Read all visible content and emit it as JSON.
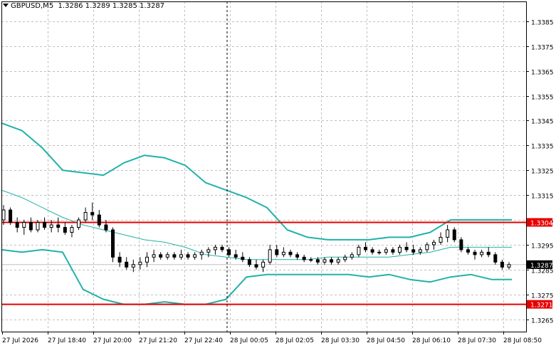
{
  "header": {
    "symbol": "GBPUSD,M5",
    "ohlc": "1.3286 1.3289 1.3285 1.3287"
  },
  "colors": {
    "background": "#ffffff",
    "grid": "#c0c0c0",
    "axis": "#000000",
    "bands": "#20b2aa",
    "level_line": "#e60000",
    "candle": "#000000"
  },
  "chart_data": {
    "type": "candlestick",
    "symbol": "GBPUSD",
    "timeframe": "M5",
    "ylim": [
      1.326,
      1.3393
    ],
    "y_ticks": [
      "1.3385",
      "1.3375",
      "1.3365",
      "1.3355",
      "1.3345",
      "1.3335",
      "1.3325",
      "1.3315",
      "1.3305",
      "1.3295",
      "1.3285",
      "1.3275",
      "1.3265"
    ],
    "x_ticks": [
      "27 Jul 2026",
      "27 Jul 18:40",
      "27 Jul 20:00",
      "27 Jul 21:20",
      "27 Jul 22:40",
      "28 Jul 00:05",
      "28 Jul 02:05",
      "28 Jul 03:30",
      "28 Jul 04:50",
      "28 Jul 06:10",
      "28 Jul 07:30",
      "28 Jul 08:50"
    ],
    "current_price": "1.3287",
    "horizontal_levels": [
      {
        "label": "1.3304",
        "value": 1.3304
      },
      {
        "label": "1.3271",
        "value": 1.3271
      }
    ],
    "grid": true,
    "bollinger_bands": {
      "upper": [
        1.3344,
        1.3341,
        1.3334,
        1.3325,
        1.3324,
        1.3323,
        1.3328,
        1.3331,
        1.333,
        1.3327,
        1.332,
        1.3317,
        1.3314,
        1.331,
        1.3301,
        1.3298,
        1.3297,
        1.3297,
        1.3297,
        1.3298,
        1.3298,
        1.33,
        1.3305,
        1.3305,
        1.3305,
        1.3305
      ],
      "middle": [
        1.3317,
        1.3314,
        1.331,
        1.3306,
        1.3303,
        1.3301,
        1.3299,
        1.3297,
        1.3296,
        1.3294,
        1.3291,
        1.329,
        1.3289,
        1.3289,
        1.3289,
        1.3289,
        1.329,
        1.329,
        1.329,
        1.329,
        1.3291,
        1.3292,
        1.3294,
        1.3294,
        1.3294,
        1.3294
      ],
      "lower": [
        1.3293,
        1.3292,
        1.3293,
        1.3292,
        1.3277,
        1.3273,
        1.3271,
        1.3271,
        1.3272,
        1.3271,
        1.3271,
        1.3273,
        1.3282,
        1.3283,
        1.3283,
        1.3283,
        1.3283,
        1.3283,
        1.3282,
        1.3283,
        1.3281,
        1.328,
        1.3282,
        1.3283,
        1.3281,
        1.3281
      ]
    },
    "candles": [
      [
        1.3305,
        1.3311,
        1.3303,
        1.3309
      ],
      [
        1.3309,
        1.331,
        1.3303,
        1.3304
      ],
      [
        1.3304,
        1.3306,
        1.33,
        1.3302
      ],
      [
        1.3302,
        1.3305,
        1.3299,
        1.3304
      ],
      [
        1.3304,
        1.3306,
        1.33,
        1.3301
      ],
      [
        1.3301,
        1.3305,
        1.33,
        1.3304
      ],
      [
        1.3304,
        1.3306,
        1.3301,
        1.3302
      ],
      [
        1.3302,
        1.3305,
        1.33,
        1.3303
      ],
      [
        1.3303,
        1.3306,
        1.33,
        1.3302
      ],
      [
        1.3302,
        1.3304,
        1.3299,
        1.33
      ],
      [
        1.33,
        1.3303,
        1.3298,
        1.3302
      ],
      [
        1.3302,
        1.3306,
        1.3301,
        1.3305
      ],
      [
        1.3305,
        1.331,
        1.3304,
        1.3308
      ],
      [
        1.3308,
        1.3312,
        1.3305,
        1.3307
      ],
      [
        1.3307,
        1.3309,
        1.3302,
        1.3303
      ],
      [
        1.3303,
        1.3305,
        1.33,
        1.3301
      ],
      [
        1.3301,
        1.3302,
        1.3288,
        1.329
      ],
      [
        1.329,
        1.3292,
        1.3286,
        1.3288
      ],
      [
        1.3288,
        1.329,
        1.3285,
        1.3286
      ],
      [
        1.3286,
        1.3289,
        1.3284,
        1.3287
      ],
      [
        1.3287,
        1.329,
        1.3285,
        1.3288
      ],
      [
        1.3288,
        1.3292,
        1.3286,
        1.329
      ],
      [
        1.329,
        1.3293,
        1.3288,
        1.3291
      ],
      [
        1.3291,
        1.3292,
        1.3289,
        1.329
      ],
      [
        1.329,
        1.3292,
        1.3289,
        1.3291
      ],
      [
        1.3291,
        1.3292,
        1.3289,
        1.329
      ],
      [
        1.329,
        1.3293,
        1.3289,
        1.3291
      ],
      [
        1.3291,
        1.3292,
        1.3289,
        1.329
      ],
      [
        1.329,
        1.3292,
        1.3289,
        1.3291
      ],
      [
        1.3291,
        1.3293,
        1.3289,
        1.3292
      ],
      [
        1.3292,
        1.3294,
        1.329,
        1.3293
      ],
      [
        1.3293,
        1.3295,
        1.3291,
        1.3294
      ],
      [
        1.3294,
        1.3295,
        1.3292,
        1.3293
      ],
      [
        1.3293,
        1.3294,
        1.329,
        1.3291
      ],
      [
        1.3291,
        1.3293,
        1.3289,
        1.329
      ],
      [
        1.329,
        1.3292,
        1.3288,
        1.3289
      ],
      [
        1.3289,
        1.329,
        1.3286,
        1.3287
      ],
      [
        1.3287,
        1.3289,
        1.3285,
        1.3286
      ],
      [
        1.3286,
        1.3289,
        1.3284,
        1.3288
      ],
      [
        1.3288,
        1.3295,
        1.3287,
        1.3293
      ],
      [
        1.3293,
        1.3295,
        1.329,
        1.3291
      ],
      [
        1.3291,
        1.3294,
        1.329,
        1.3292
      ],
      [
        1.3292,
        1.3293,
        1.329,
        1.3291
      ],
      [
        1.3291,
        1.3292,
        1.3289,
        1.329
      ],
      [
        1.329,
        1.3291,
        1.3288,
        1.3289
      ],
      [
        1.3289,
        1.329,
        1.3288,
        1.3289
      ],
      [
        1.3289,
        1.329,
        1.3287,
        1.3288
      ],
      [
        1.3288,
        1.329,
        1.3287,
        1.3289
      ],
      [
        1.3289,
        1.329,
        1.3287,
        1.3288
      ],
      [
        1.3288,
        1.329,
        1.3287,
        1.3289
      ],
      [
        1.3289,
        1.3291,
        1.3288,
        1.329
      ],
      [
        1.329,
        1.3292,
        1.3289,
        1.3291
      ],
      [
        1.3291,
        1.3295,
        1.329,
        1.3294
      ],
      [
        1.3294,
        1.3296,
        1.3292,
        1.3293
      ],
      [
        1.3293,
        1.3294,
        1.3291,
        1.3292
      ],
      [
        1.3292,
        1.3293,
        1.3291,
        1.3292
      ],
      [
        1.3292,
        1.3294,
        1.3291,
        1.3293
      ],
      [
        1.3293,
        1.3294,
        1.3291,
        1.3292
      ],
      [
        1.3292,
        1.3295,
        1.3291,
        1.3294
      ],
      [
        1.3294,
        1.3296,
        1.3292,
        1.3293
      ],
      [
        1.3293,
        1.3295,
        1.3291,
        1.3292
      ],
      [
        1.3292,
        1.3294,
        1.3291,
        1.3293
      ],
      [
        1.3293,
        1.3296,
        1.3292,
        1.3295
      ],
      [
        1.3295,
        1.3297,
        1.3293,
        1.3296
      ],
      [
        1.3296,
        1.33,
        1.3295,
        1.3298
      ],
      [
        1.3298,
        1.3303,
        1.3296,
        1.3301
      ],
      [
        1.3301,
        1.3302,
        1.3296,
        1.3297
      ],
      [
        1.3297,
        1.3298,
        1.3292,
        1.3293
      ],
      [
        1.3293,
        1.3294,
        1.3291,
        1.3292
      ],
      [
        1.3292,
        1.3293,
        1.3289,
        1.3291
      ],
      [
        1.3291,
        1.3293,
        1.329,
        1.3292
      ],
      [
        1.3292,
        1.3294,
        1.329,
        1.3291
      ],
      [
        1.3291,
        1.3292,
        1.3287,
        1.3288
      ],
      [
        1.3288,
        1.3289,
        1.3285,
        1.3286
      ],
      [
        1.3286,
        1.3288,
        1.3285,
        1.3287
      ]
    ]
  }
}
